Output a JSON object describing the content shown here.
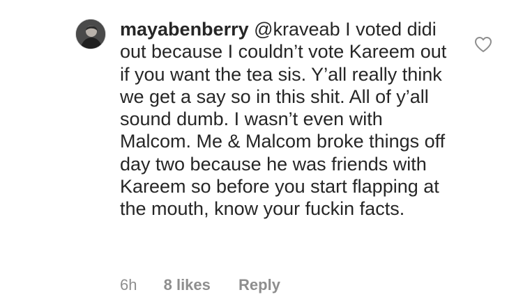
{
  "comment": {
    "avatar_icon": "user-avatar",
    "username": "mayabenberry",
    "mention": "@kraveab",
    "text": "I voted didi out because I couldn’t vote Kareem out if you want the tea sis. Y’all really think we get a say so in this shit. All of y’all sound dumb. I wasn’t even with Malcom. Me & Malcom broke things off day two because he was friends with Kareem so before you start flapping at the mouth, know your fuckin facts.",
    "like_icon": "heart-outline-icon"
  },
  "meta": {
    "time": "6h",
    "likes": "8 likes",
    "reply": "Reply"
  },
  "colors": {
    "text": "#262626",
    "secondary": "#8e8e8e",
    "background": "#ffffff"
  }
}
